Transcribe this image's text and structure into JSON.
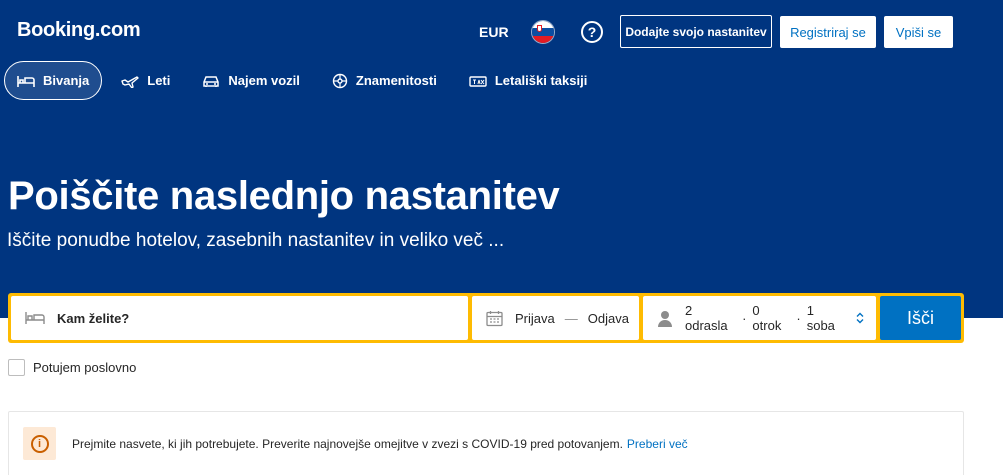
{
  "header": {
    "logo": "Booking.com",
    "currency": "EUR",
    "help_glyph": "?",
    "add_property_label": "Dodajte svojo nastanitev",
    "register_label": "Registriraj se",
    "login_label": "Vpiši se",
    "flag_icon": "slovenia-flag-icon"
  },
  "nav": {
    "items": [
      {
        "label": "Bivanja",
        "icon": "bed-icon",
        "active": true
      },
      {
        "label": "Leti",
        "icon": "plane-icon",
        "active": false
      },
      {
        "label": "Najem vozil",
        "icon": "car-icon",
        "active": false
      },
      {
        "label": "Znamenitosti",
        "icon": "attractions-icon",
        "active": false
      },
      {
        "label": "Letališki taksiji",
        "icon": "taxi-icon",
        "active": false
      }
    ]
  },
  "hero": {
    "title": "Poiščite naslednjo nastanitev",
    "subtitle": "Iščite ponudbe hotelov, zasebnih nastanitev in veliko več ..."
  },
  "search": {
    "destination_placeholder": "Kam želite?",
    "checkin_label": "Prijava",
    "date_separator": "—",
    "checkout_label": "Odjava",
    "adults": "2 odrasla",
    "children": "0 otrok",
    "rooms": "1 soba",
    "separator": "·",
    "search_label": "Išči"
  },
  "business": {
    "label": "Potujem poslovno",
    "checked": false
  },
  "notice": {
    "icon_glyph": "i",
    "text": "Prejmite nasvete, ki jih potrebujete. Preverite najnovejše omejitve v zvezi s COVID-19 pred potovanjem.",
    "link": "Preberi več"
  },
  "colors": {
    "brand_blue": "#003580",
    "accent_yellow": "#febb02",
    "button_blue": "#0071c2",
    "info_orange": "#c95f00"
  }
}
